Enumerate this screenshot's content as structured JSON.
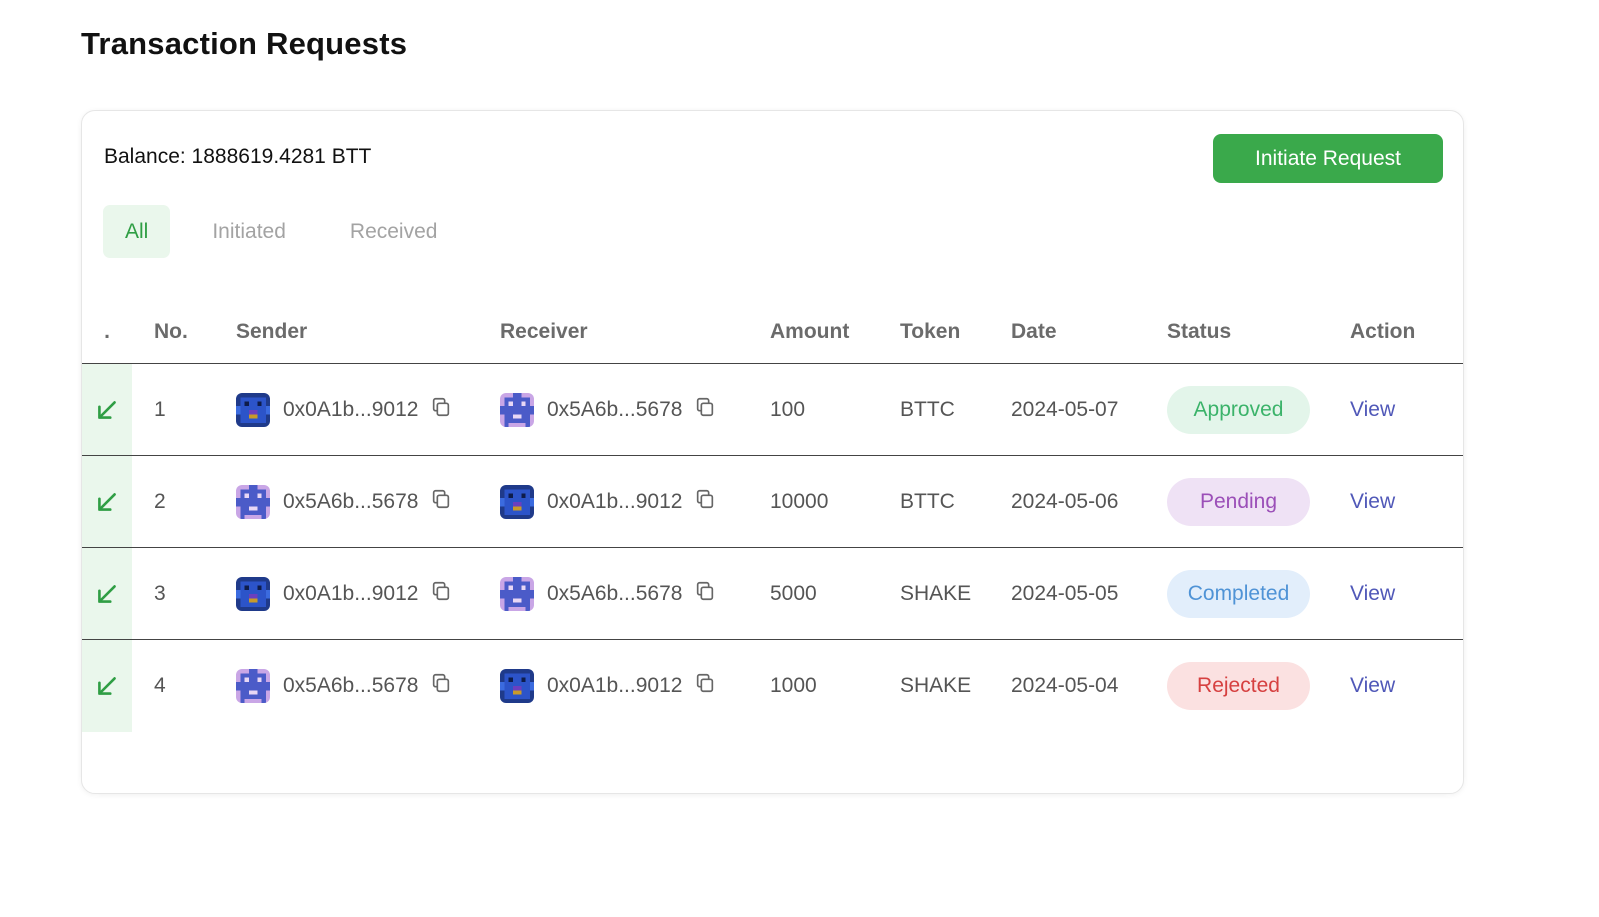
{
  "page": {
    "title": "Transaction Requests"
  },
  "card": {
    "balance": "Balance: 1888619.4281 BTT",
    "initiate_label": "Initiate Request",
    "tabs": [
      {
        "label": "All",
        "active": true
      },
      {
        "label": "Initiated",
        "active": false
      },
      {
        "label": "Received",
        "active": false
      }
    ]
  },
  "table": {
    "headers": {
      "dir": ".",
      "no": "No.",
      "sender": "Sender",
      "receiver": "Receiver",
      "amount": "Amount",
      "token": "Token",
      "date": "Date",
      "status": "Status",
      "action": "Action"
    },
    "rows": [
      {
        "no": "1",
        "sender": "0x0A1b...9012",
        "sender_avatar": "avatar-blue",
        "receiver": "0x5A6b...5678",
        "receiver_avatar": "avatar-purple",
        "amount": "100",
        "token": "BTTC",
        "date": "2024-05-07",
        "status": "Approved",
        "status_kind": "approved",
        "action": "View",
        "direction_icon": "arrow-down-left-icon"
      },
      {
        "no": "2",
        "sender": "0x5A6b...5678",
        "sender_avatar": "avatar-purple",
        "receiver": "0x0A1b...9012",
        "receiver_avatar": "avatar-blue",
        "amount": "10000",
        "token": "BTTC",
        "date": "2024-05-06",
        "status": "Pending",
        "status_kind": "pending",
        "action": "View",
        "direction_icon": "arrow-down-left-icon"
      },
      {
        "no": "3",
        "sender": "0x0A1b...9012",
        "sender_avatar": "avatar-blue",
        "receiver": "0x5A6b...5678",
        "receiver_avatar": "avatar-purple",
        "amount": "5000",
        "token": "SHAKE",
        "date": "2024-05-05",
        "status": "Completed",
        "status_kind": "completed",
        "action": "View",
        "direction_icon": "arrow-down-left-icon"
      },
      {
        "no": "4",
        "sender": "0x5A6b...5678",
        "sender_avatar": "avatar-purple",
        "receiver": "0x0A1b...9012",
        "receiver_avatar": "avatar-blue",
        "amount": "1000",
        "token": "SHAKE",
        "date": "2024-05-04",
        "status": "Rejected",
        "status_kind": "rejected",
        "action": "View",
        "direction_icon": "arrow-down-left-icon"
      }
    ]
  },
  "colors": {
    "accent": "#3aa94b",
    "link": "#5058b8",
    "approved": "#3bb36a",
    "pending": "#9b4fb8",
    "completed": "#4f93d6",
    "rejected": "#d64040"
  }
}
